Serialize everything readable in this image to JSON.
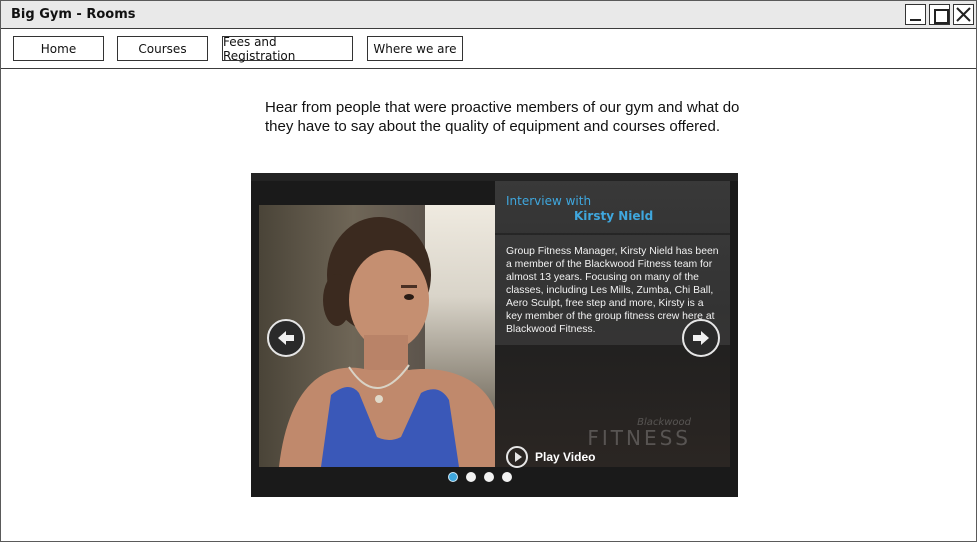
{
  "window": {
    "title": "Big Gym - Rooms"
  },
  "nav": {
    "items": [
      {
        "label": "Home"
      },
      {
        "label": "Courses"
      },
      {
        "label": "Fees and Registration"
      },
      {
        "label": "Where we are"
      }
    ]
  },
  "intro": {
    "text": "Hear from people that were proactive members of our gym and what do they have to say about the quality of equipment and courses offered."
  },
  "carousel": {
    "interview_label": "Interview with",
    "interview_name": "Kirsty Nield",
    "description": "Group Fitness Manager, Kirsty Nield has been a member of the Blackwood Fitness team for almost 13 years. Focusing on many of the classes, including Les Mills, Zumba, Chi Ball, Aero Sculpt, free step and more, Kirsty is a key member of the group fitness crew here at Blackwood Fitness.",
    "brand_top": "Blackwood",
    "brand_main": "FITNESS",
    "play_label": "Play Video",
    "slides_count": 4,
    "active_slide": 1,
    "accent_color": "#3fa7de",
    "icons": [
      "arrow-left-icon",
      "arrow-right-icon",
      "play-icon"
    ]
  }
}
